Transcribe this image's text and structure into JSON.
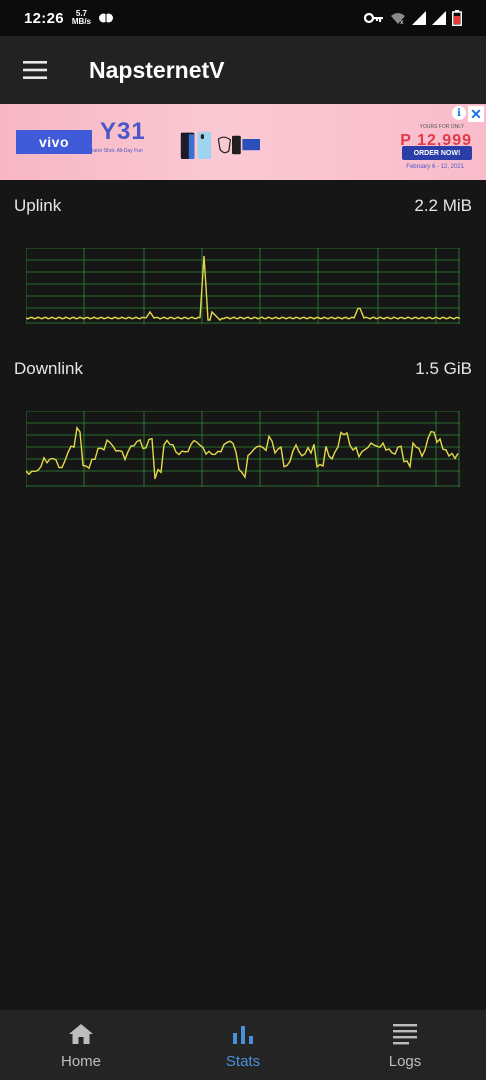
{
  "status_bar": {
    "time": "12:26",
    "speed_value": "5.7",
    "speed_unit": "MB/s"
  },
  "app_bar": {
    "title": "NapsternetV"
  },
  "ad": {
    "brand": "vivo",
    "model": "Y31",
    "tagline": "Clearer Shot, All-Day Fun",
    "price": "P 12,999",
    "price_label": "YOURS FOR ONLY",
    "order_label": "ORDER NOW!",
    "date": "February 6 - 12, 2021"
  },
  "stats": {
    "uplink": {
      "label": "Uplink",
      "value": "2.2 MiB"
    },
    "downlink": {
      "label": "Downlink",
      "value": "1.5 GiB"
    }
  },
  "bottom_nav": {
    "items": [
      {
        "label": "Home",
        "icon": "home-icon",
        "active": false
      },
      {
        "label": "Stats",
        "icon": "bar-chart-icon",
        "active": true
      },
      {
        "label": "Logs",
        "icon": "list-icon",
        "active": false
      }
    ]
  },
  "colors": {
    "accent": "#4a90d9",
    "graph_line": "#e3d94a",
    "graph_grid": "#2f8a35",
    "background": "#161616",
    "app_bar": "#222222"
  }
}
